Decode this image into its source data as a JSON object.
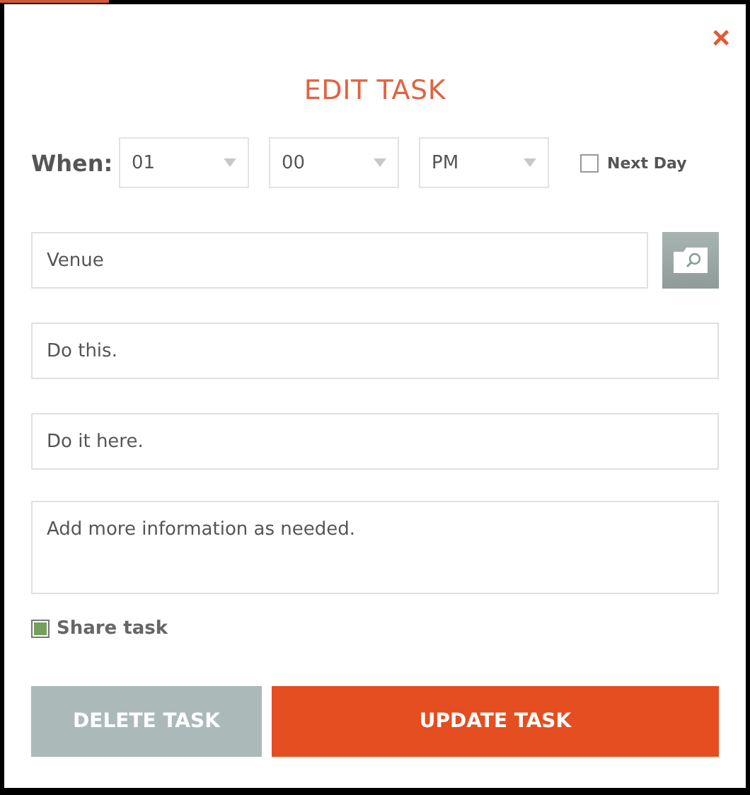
{
  "dialog": {
    "title": "EDIT TASK",
    "close": "×"
  },
  "when": {
    "label": "When:",
    "selects": [
      {
        "value": "01"
      },
      {
        "value": "00"
      },
      {
        "value": "PM"
      }
    ],
    "next_day": {
      "label": "Next Day",
      "checked": false
    }
  },
  "fields": [
    {
      "kind": "venue",
      "placeholder": "Venue"
    },
    {
      "kind": "text",
      "placeholder": "Do this."
    },
    {
      "kind": "text",
      "placeholder": "Do it here."
    },
    {
      "kind": "area",
      "placeholder": "Add more information as needed."
    }
  ],
  "share": {
    "label": "Share task",
    "checked": true
  },
  "buttons": [
    {
      "kind": "delete",
      "label": "DELETE TASK"
    },
    {
      "kind": "update",
      "label": "UPDATE TASK"
    }
  ]
}
